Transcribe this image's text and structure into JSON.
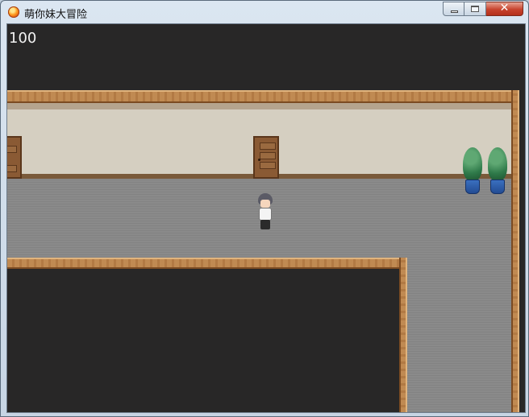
{
  "window": {
    "title": "萌你妹大冒险",
    "icon": "game-orb-icon",
    "controls": {
      "minimize_icon": "minimize-icon",
      "maximize_icon": "maximize-icon",
      "close_glyph": "✕"
    }
  },
  "hud": {
    "score": "100"
  },
  "scene": {
    "objects": [
      {
        "name": "door",
        "count": 2
      },
      {
        "name": "potted-plant",
        "count": 2
      },
      {
        "name": "player-character",
        "count": 1
      }
    ],
    "colors": {
      "background": "#282727",
      "wall": "#d5cfc1",
      "floor": "#8a8a8a",
      "wood_frame": "#c08a52"
    }
  }
}
